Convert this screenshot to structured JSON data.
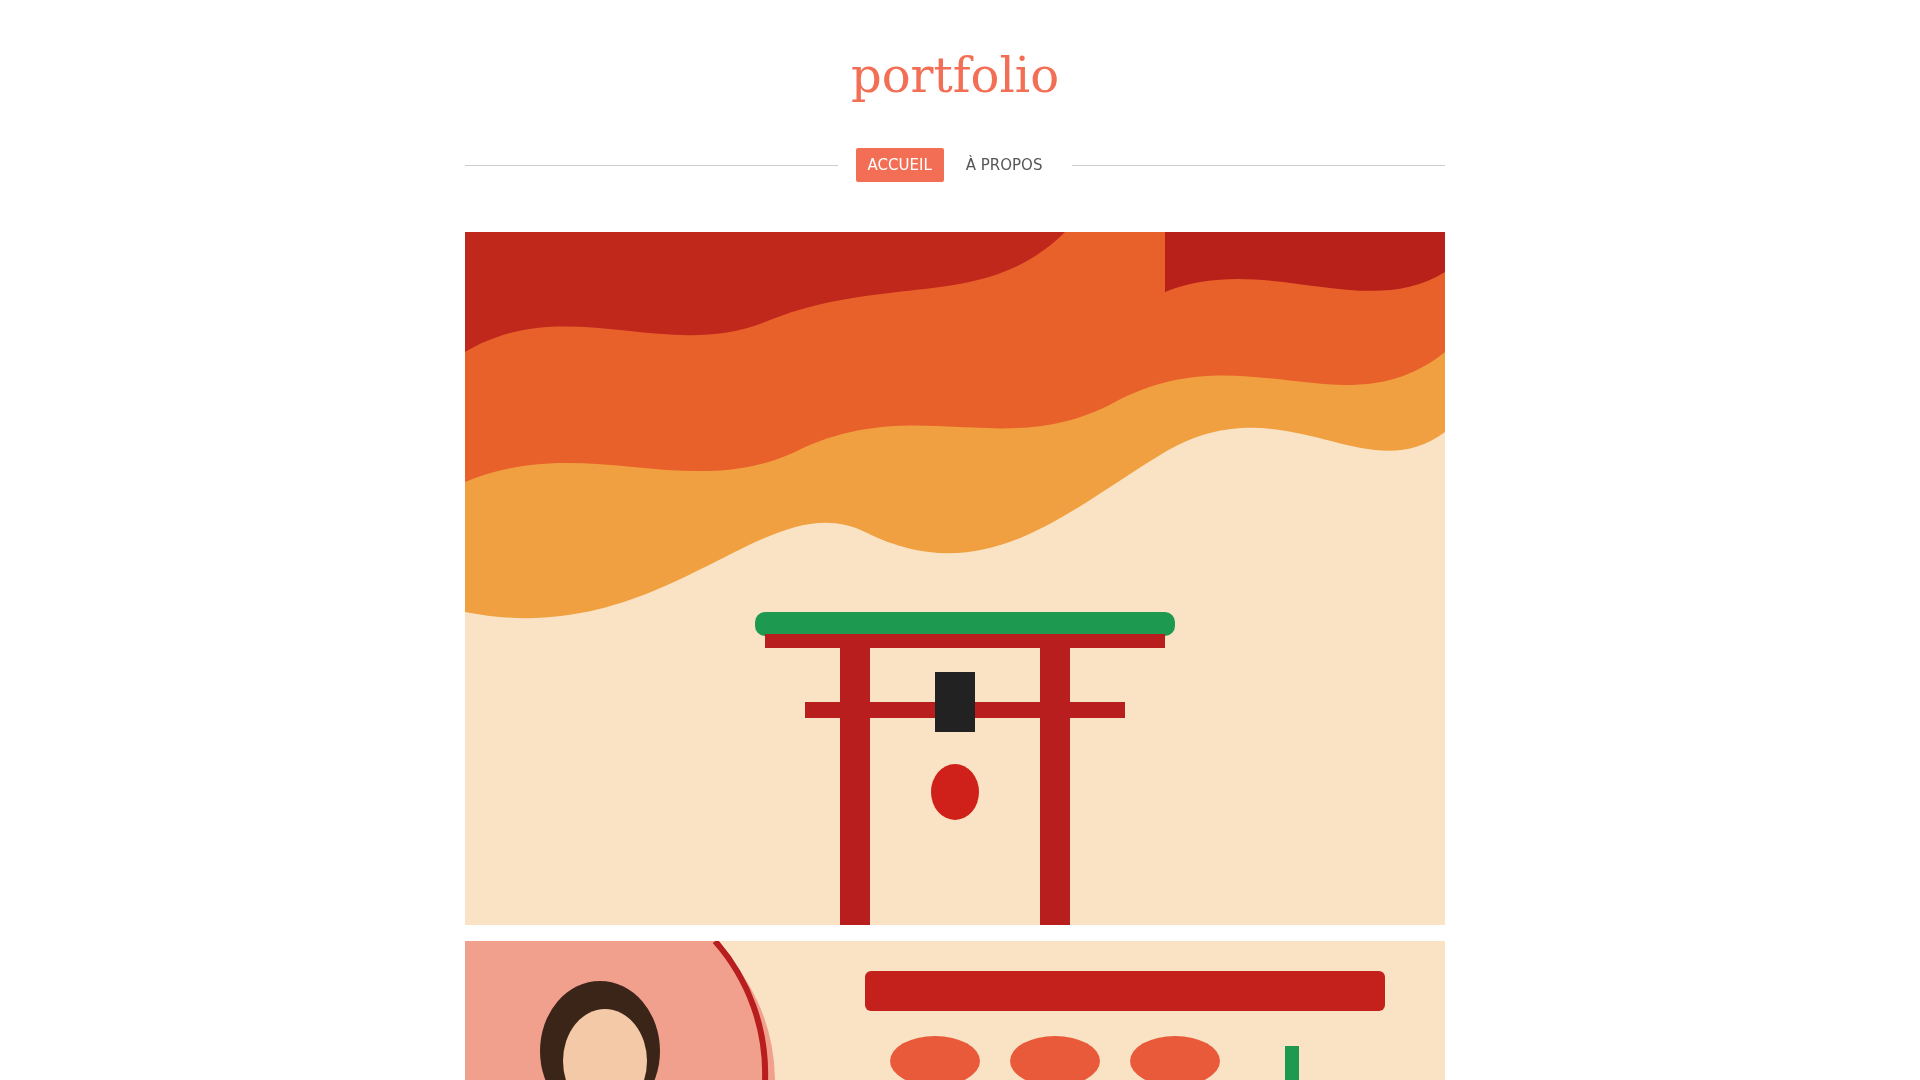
{
  "site": {
    "title": "portfolio"
  },
  "nav": [
    {
      "label": "ACCUEIL",
      "selected": true
    },
    {
      "label": "À PROPOS",
      "selected": false
    }
  ]
}
